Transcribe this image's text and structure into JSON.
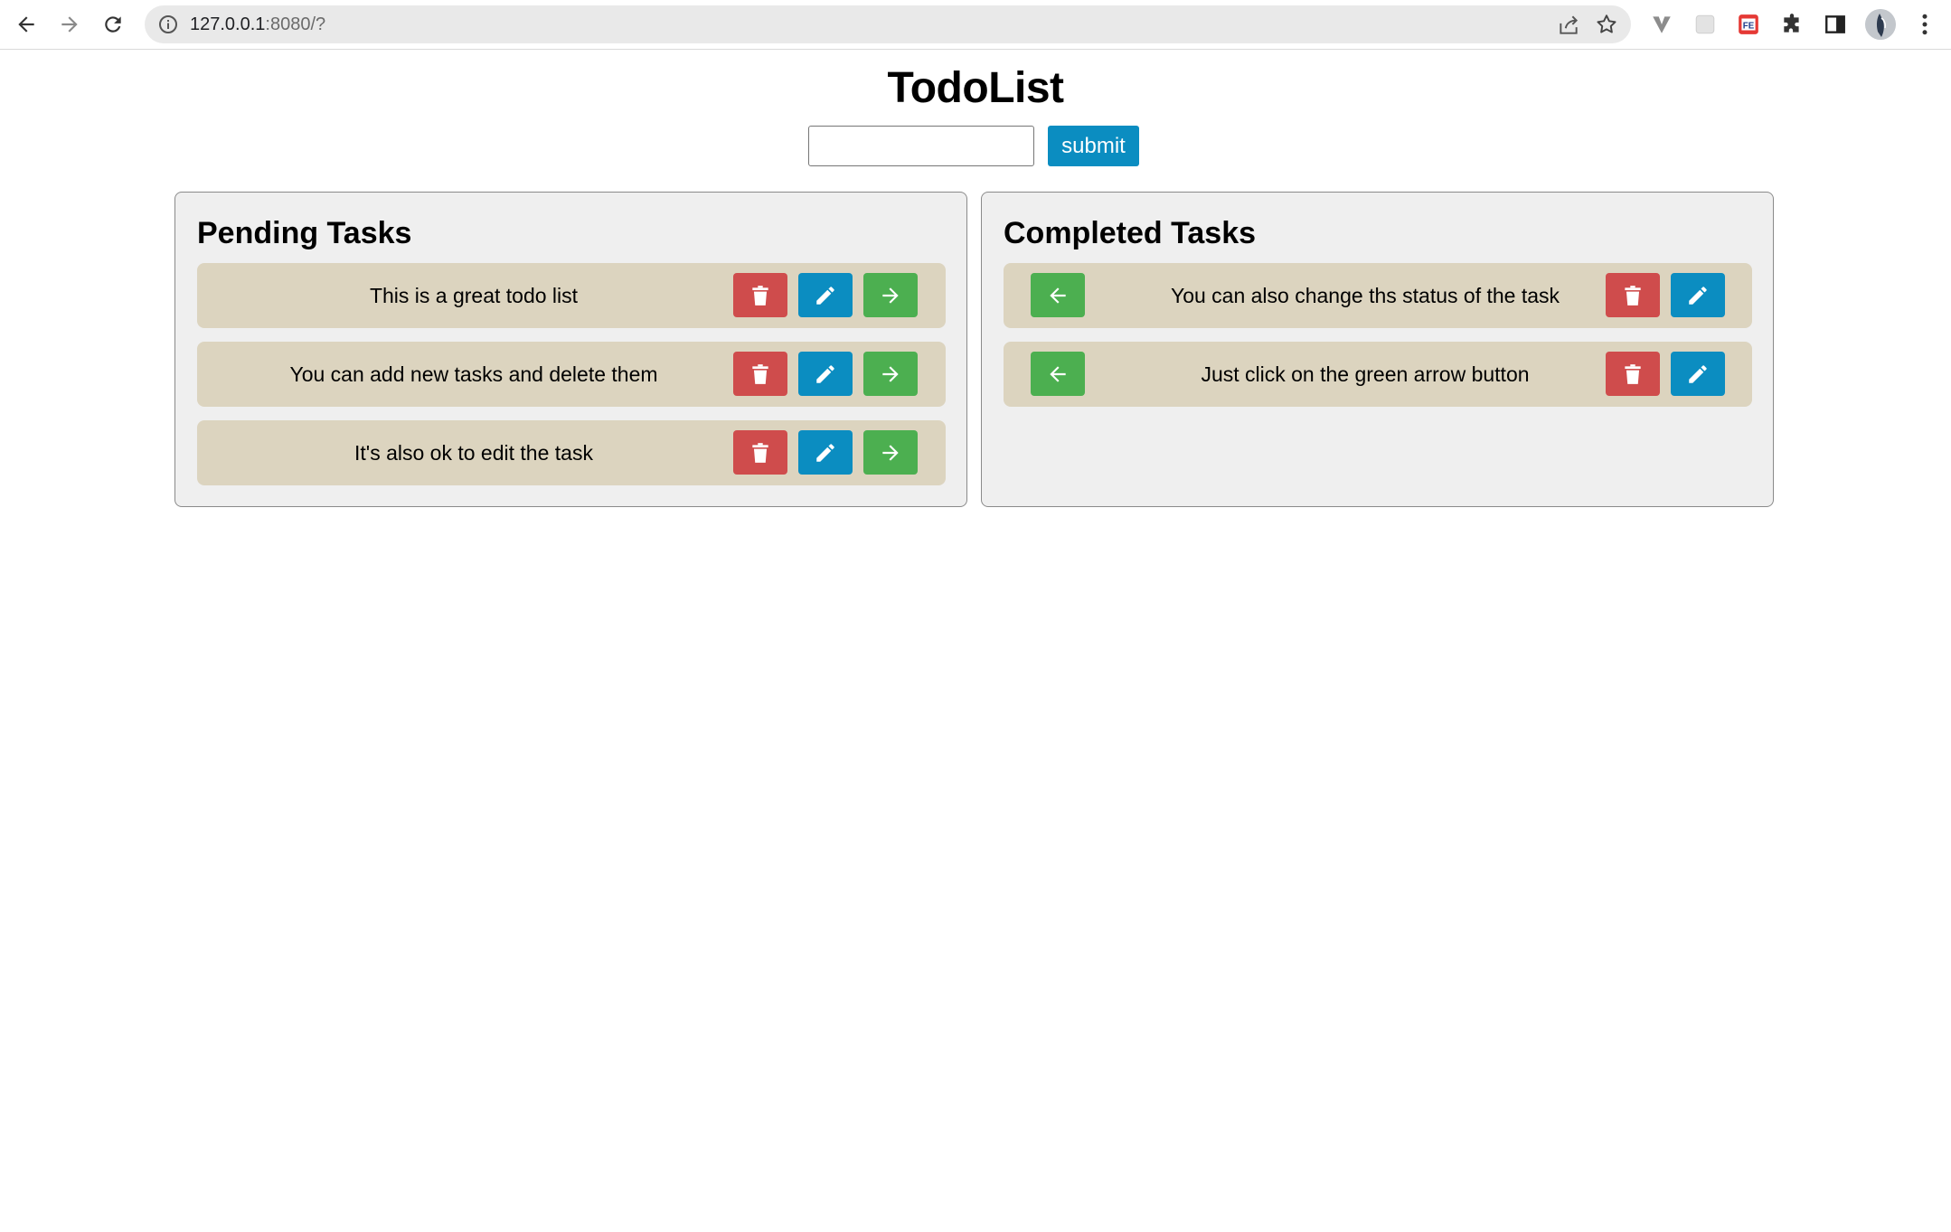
{
  "browser": {
    "url_host": "127.0.0.1",
    "url_rest": ":8080/?",
    "icons": [
      "back-arrow-icon",
      "forward-arrow-icon",
      "reload-icon",
      "info-icon",
      "share-icon",
      "star-icon",
      "extension-icons",
      "puzzle-icon",
      "sidebar-icon",
      "avatar",
      "menu-dots-icon"
    ]
  },
  "app": {
    "title": "TodoList",
    "input": {
      "value": "",
      "placeholder": ""
    },
    "submit_label": "submit"
  },
  "pending": {
    "heading": "Pending Tasks",
    "tasks": [
      {
        "text": "This is a great todo list"
      },
      {
        "text": "You can add new tasks and delete them"
      },
      {
        "text": "It's also ok to edit the task"
      }
    ]
  },
  "completed": {
    "heading": "Completed Tasks",
    "tasks": [
      {
        "text": "You can also change ths status of the task"
      },
      {
        "text": "Just click on the green arrow button"
      }
    ]
  },
  "colors": {
    "delete": "#cf4c4c",
    "edit": "#0b8dc1",
    "move": "#4caf50",
    "task_bg": "#dcd4bf",
    "panel_bg": "#efefef",
    "submit": "#0b8dc1"
  }
}
